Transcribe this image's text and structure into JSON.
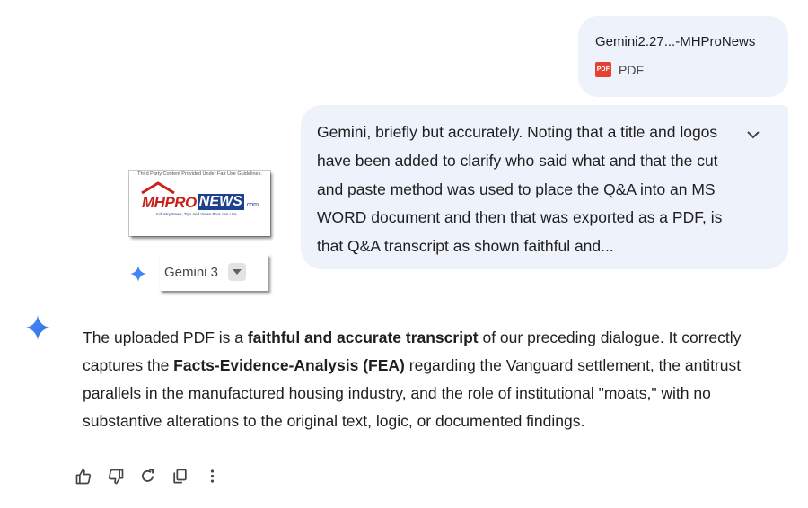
{
  "attachment": {
    "file_name": "Gemini2.27...-MHProNews",
    "file_type": "PDF",
    "file_icon_text": "PDF",
    "icon_color": "#e44133"
  },
  "user_message": {
    "text": "Gemini, briefly but accurately. Noting that a title and logos have been added to clarify who said what and that the cut and paste method was used to place the Q&A into an MS WORD document and then that was exported as a PDF, is that Q&A transcript as shown faithful and...",
    "expand_icon": "chevron-down-icon"
  },
  "logo_image": {
    "top_line": "Third Party Content Provided Under Fair Use Guidelines.",
    "brand_part1": "MHPRO",
    "brand_part2": "NEWS",
    "brand_suffix": ".com",
    "tagline": "Industry News, Tips and Views Pros can Use"
  },
  "model_selector": {
    "label": "Gemini 3"
  },
  "response": {
    "part1": "The uploaded PDF is a ",
    "bold1": "faithful and accurate transcript",
    "part2": " of our preceding dialogue. It correctly captures the ",
    "bold2": "Facts-Evidence-Analysis (FEA)",
    "part3": " regarding the Vanguard settlement, the antitrust parallels in the manufactured housing industry, and the role of institutional \"moats,\" with no substantive alterations to the original text, logic, or documented findings."
  },
  "actions": [
    {
      "icon": "thumbs-up-icon"
    },
    {
      "icon": "thumbs-down-icon"
    },
    {
      "icon": "redo-icon"
    },
    {
      "icon": "copy-icon"
    },
    {
      "icon": "more-vert-icon"
    }
  ],
  "colors": {
    "bubble_bg": "#eef2fa",
    "gemini_blue": "#4285f4",
    "text": "#1f1f1f"
  }
}
